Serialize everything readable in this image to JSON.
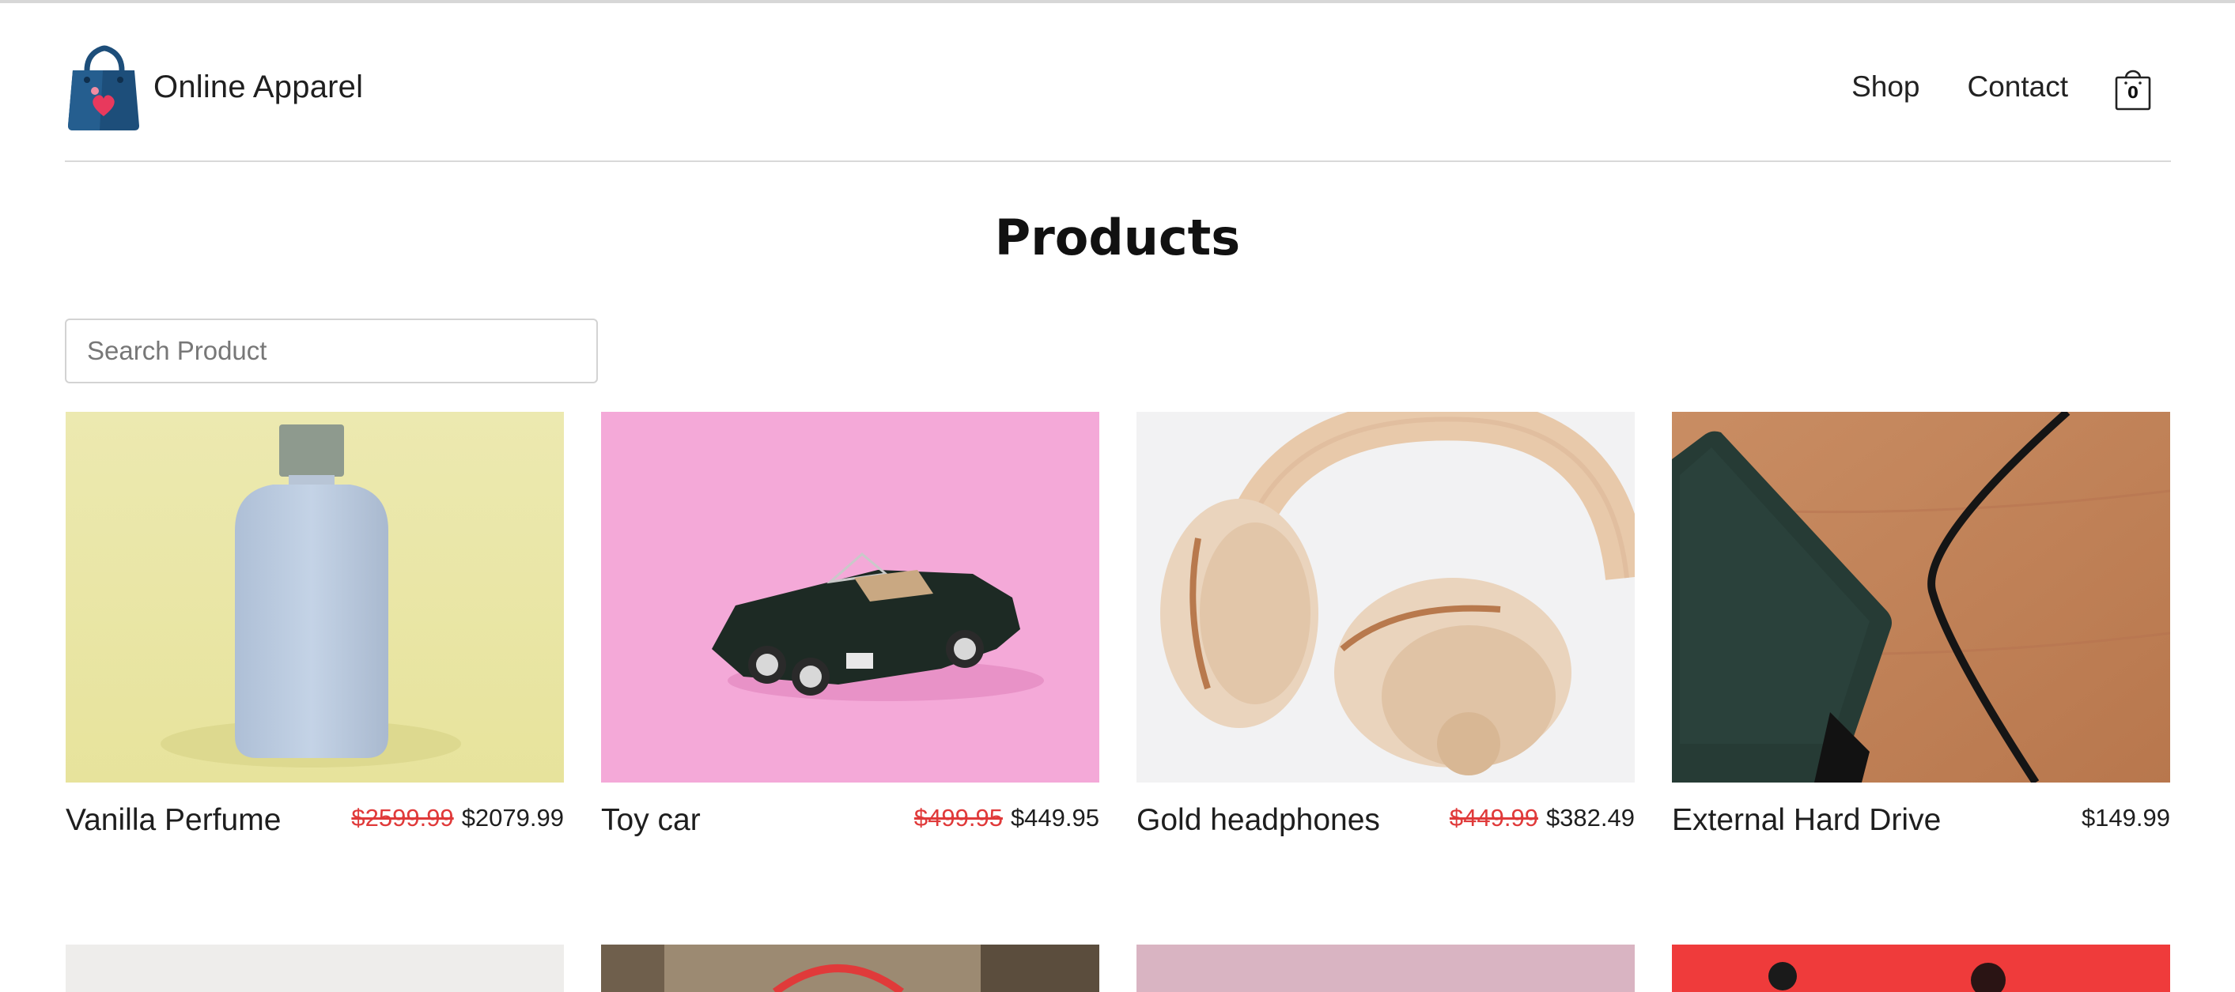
{
  "brand": {
    "name": "Online Apparel",
    "logo_icon": "shopping-bag-heart-icon"
  },
  "nav": {
    "items": [
      {
        "label": "Shop"
      },
      {
        "label": "Contact"
      }
    ],
    "cart": {
      "count": "0",
      "icon": "shopping-bag-icon"
    }
  },
  "page": {
    "title": "Products"
  },
  "search": {
    "placeholder": "Search Product",
    "value": ""
  },
  "colors": {
    "sale": "#e03a3a",
    "logo_blue": "#1d4e7a",
    "logo_heart": "#e8395d"
  },
  "products": [
    {
      "name": "Vanilla Perfume",
      "old_price": "$2599.99",
      "price": "$2079.99",
      "image": "perfume-bottle-image"
    },
    {
      "name": "Toy car",
      "old_price": "$499.95",
      "price": "$449.95",
      "image": "toy-car-image"
    },
    {
      "name": "Gold headphones",
      "old_price": "$449.99",
      "price": "$382.49",
      "image": "headphones-image"
    },
    {
      "name": "External Hard Drive",
      "old_price": "",
      "price": "$149.99",
      "image": "hard-drive-image"
    }
  ]
}
